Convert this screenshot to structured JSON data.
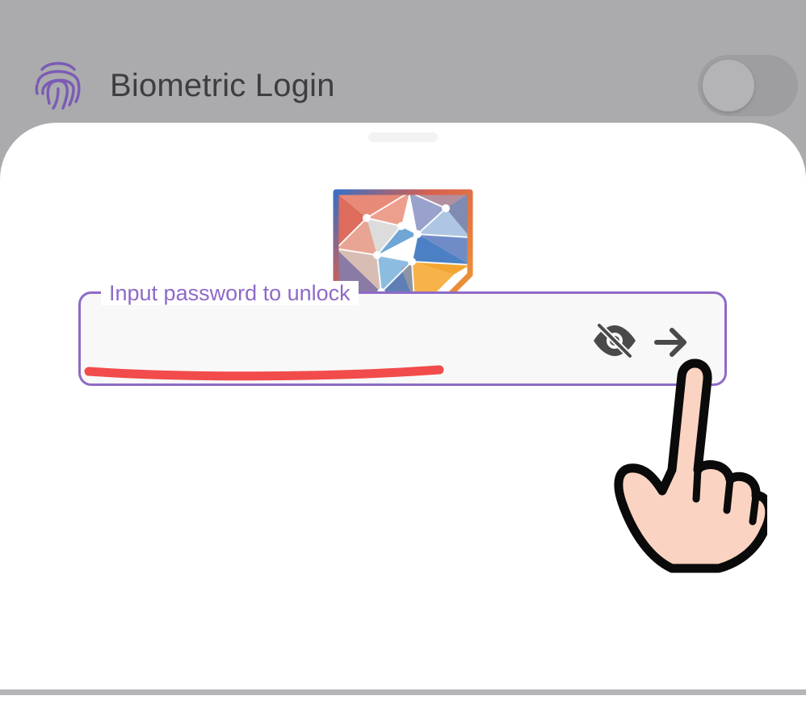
{
  "settings": {
    "biometric_label": "Biometric Login",
    "biometric_enabled": false
  },
  "unlock_sheet": {
    "password_field": {
      "label": "Input password to unlock",
      "value": ""
    }
  },
  "icons": {
    "fingerprint": "fingerprint-icon",
    "eye": "eye-off-icon",
    "submit": "arrow-right-icon"
  },
  "colors": {
    "accent": "#8e6ac7",
    "annotation": "#f24b4b",
    "overlay": "#ababad"
  }
}
